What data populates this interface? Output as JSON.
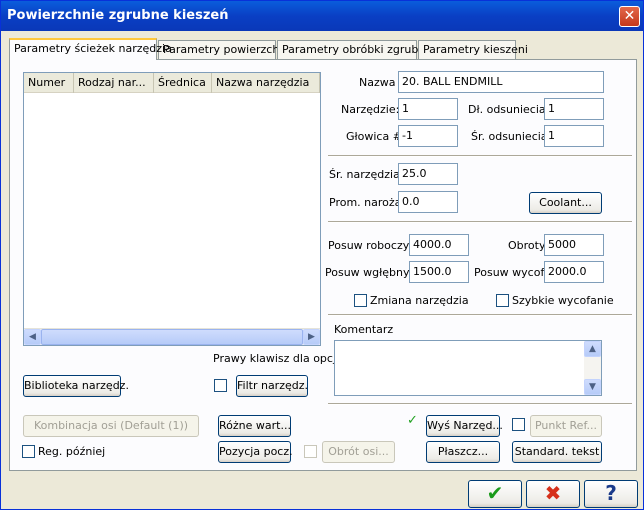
{
  "window": {
    "title": "Powierzchnie zgrubne kieszeń",
    "close_label": "✕"
  },
  "tabs": [
    {
      "label": "Parametry ścieżek narzędzia"
    },
    {
      "label": "Parametry powierzchni"
    },
    {
      "label": "Parametry obróbki zgrubnej"
    },
    {
      "label": "Parametry kieszeni"
    }
  ],
  "tool_list": {
    "columns": [
      "Numer",
      "Rodzaj nar...",
      "Średnica",
      "Nazwa narzędzia"
    ],
    "right_click_hint": "Prawy klawisz dla opcji"
  },
  "tool": {
    "name_label": "Nazwa",
    "name_value": "20. BALL ENDMILL",
    "tool_label": "Narzędzie:",
    "tool_value": "1",
    "length_offset_label": "Dł. odsuniecia:",
    "length_offset_value": "1",
    "head_label": "Głowica #",
    "head_value": "-1",
    "dia_offset_label": "Śr. odsuniecia:",
    "dia_offset_value": "1",
    "diameter_label": "Śr. narzędzia:",
    "diameter_value": "25.0",
    "corner_radius_label": "Prom. naroża:",
    "corner_radius_value": "0.0",
    "coolant_label": "Coolant...",
    "feed_label": "Posuw roboczy:",
    "feed_value": "4000.0",
    "spindle_label": "Obroty",
    "spindle_value": "5000",
    "plunge_label": "Posuw wgłębny:",
    "plunge_value": "1500.0",
    "retract_label": "Posuw wycof:",
    "retract_value": "2000.0",
    "tool_change_label": "Zmiana narzędzia",
    "tool_change_checked": false,
    "rapid_retract_label": "Szybkie wycofanie",
    "rapid_retract_checked": false,
    "comment_label": "Komentarz",
    "comment_value": ""
  },
  "buttons": {
    "tool_library": "Biblioteka narzędz.",
    "tool_filter": "Filtr narzędz.",
    "tool_filter_checked": false,
    "axis_combination": "Kombinacja osi (Default (1))",
    "misc_values": "Różne wart...",
    "show_tool": "Wyś Narzęd...",
    "show_tool_checked": true,
    "ref_point": "Punkt Ref...",
    "ref_point_checked": false,
    "reg_later": "Reg. później",
    "reg_later_checked": false,
    "home_position": "Pozycja pocz.",
    "axis_rotation": "Obrót osi...",
    "axis_rotation_checked": false,
    "planes": "Płaszcz...",
    "standard_text": "Standard. tekst"
  },
  "dialog": {
    "ok_symbol": "✔",
    "cancel_symbol": "✖",
    "help_symbol": "?"
  },
  "colors": {
    "ok": "#1a9a1a",
    "cancel": "#d6301a",
    "help": "#1a3a8a"
  }
}
